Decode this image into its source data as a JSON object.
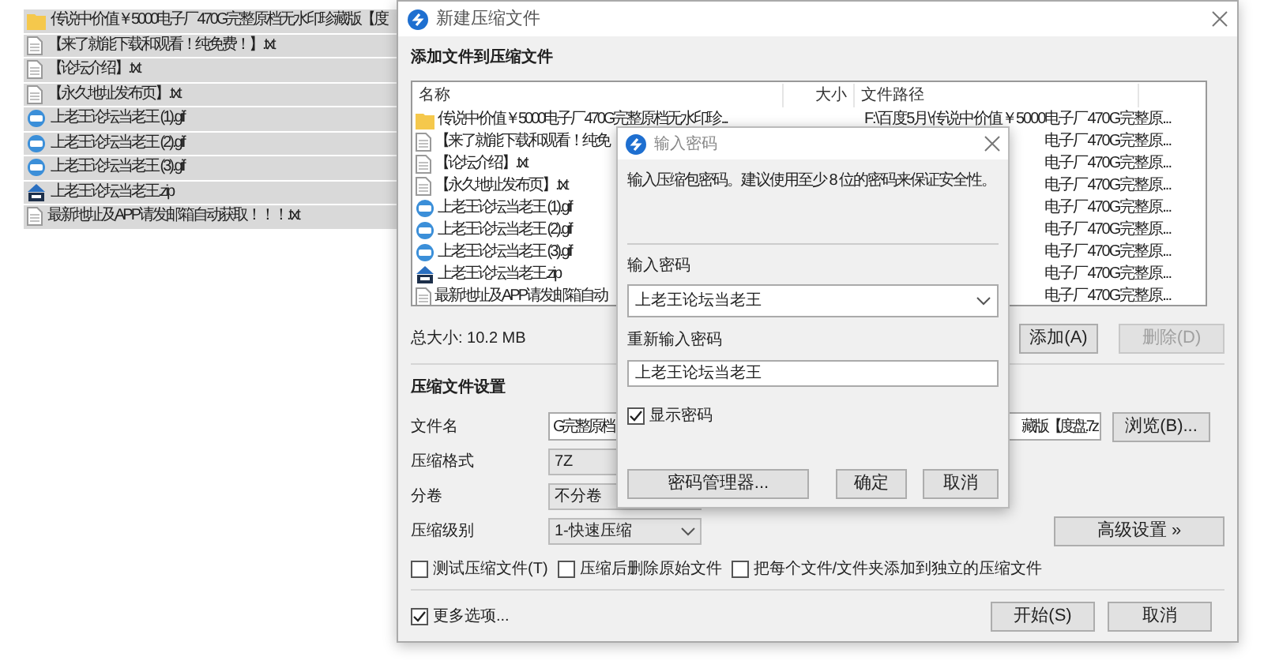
{
  "explorer": {
    "items": [
      {
        "name": "传说中价值￥5000电子厂470G完整原档无水印珍藏版【度",
        "kind": "folder"
      },
      {
        "name": "【来了就能下载和观看！纯免费！】.txt",
        "kind": "txt"
      },
      {
        "name": "【论坛介绍】.txt",
        "kind": "txt"
      },
      {
        "name": "【永久地址发布页】.txt",
        "kind": "txt"
      },
      {
        "name": "上老王论坛当老王 (1).gif",
        "kind": "gif"
      },
      {
        "name": "上老王论坛当老王 (2).gif",
        "kind": "gif"
      },
      {
        "name": "上老王论坛当老王 (3).gif",
        "kind": "gif"
      },
      {
        "name": "上老王论坛当老王.zip",
        "kind": "zip"
      },
      {
        "name": "最新地址及APP请发邮箱自动获取！！！.txt",
        "kind": "txt"
      }
    ]
  },
  "main_window": {
    "title": "新建压缩文件",
    "section": "添加文件到压缩文件",
    "table": {
      "columns": [
        "名称",
        "大小",
        "文件路径"
      ],
      "rows": [
        {
          "name": "传说中价值￥5000电子厂470G完整原档无水印珍...",
          "kind": "folder",
          "path": "F:\\百度5月\\传说中价值￥5000电子厂470G完整原..."
        },
        {
          "name": "【来了就能下载和观看！纯免",
          "kind": "txt",
          "path": "电子厂470G完整原..."
        },
        {
          "name": "【论坛介绍】.txt",
          "kind": "txt",
          "path": "电子厂470G完整原..."
        },
        {
          "name": "【永久地址发布页】.txt",
          "kind": "txt",
          "path": "电子厂470G完整原..."
        },
        {
          "name": "上老王论坛当老王 (1).gif",
          "kind": "gif",
          "path": "电子厂470G完整原..."
        },
        {
          "name": "上老王论坛当老王 (2).gif",
          "kind": "gif",
          "path": "电子厂470G完整原..."
        },
        {
          "name": "上老王论坛当老王 (3).gif",
          "kind": "gif",
          "path": "电子厂470G完整原..."
        },
        {
          "name": "上老王论坛当老王.zip",
          "kind": "zip",
          "path": "电子厂470G完整原..."
        },
        {
          "name": "最新地址及APP请发邮箱自动",
          "kind": "txt",
          "path": "电子厂470G完整原..."
        }
      ]
    },
    "total_size": "总大小: 10.2 MB",
    "add_button": {
      "label": "添加(A)",
      "disabled": false
    },
    "delete_button": {
      "label": "删除(D)",
      "disabled": true
    },
    "settings_heading": "压缩文件设置",
    "filename": {
      "label": "文件名",
      "value_start": "G完整原档",
      "value_end": "藏版【度盘.7z"
    },
    "browse_button": "浏览(B)...",
    "format": {
      "label": "压缩格式",
      "value": "7Z"
    },
    "volume": {
      "label": "分卷",
      "value": "不分卷"
    },
    "level": {
      "label": "压缩级别",
      "value": "1-快速压缩"
    },
    "advanced_button": "高级设置 »",
    "options": [
      {
        "label": "测试压缩文件(T)",
        "checked": false
      },
      {
        "label": "压缩后删除原始文件",
        "checked": false
      },
      {
        "label": "把每个文件/文件夹添加到独立的压缩文件",
        "checked": false
      }
    ],
    "more_options": {
      "label": "更多选项...",
      "checked": true
    },
    "start_button": "开始(S)",
    "cancel_button": "取消"
  },
  "password_dialog": {
    "title": "输入密码",
    "hint": "输入压缩包密码。建议使用至少 8 位的密码来保证安全性。",
    "password_label": "输入密码",
    "password_value": "上老王论坛当老王",
    "confirm_label": "重新输入密码",
    "confirm_value": "上老王论坛当老王",
    "show_password": {
      "label": "显示密码",
      "checked": true
    },
    "manager_button": "密码管理器...",
    "ok_button": "确定",
    "cancel_button": "取消"
  }
}
